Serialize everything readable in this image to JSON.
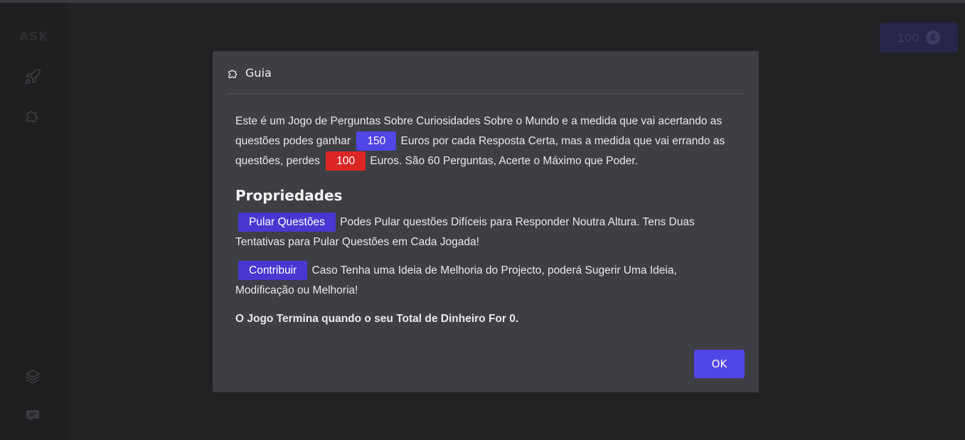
{
  "sidebar": {
    "logo": "ASK",
    "icons": [
      "rocket-icon",
      "puzzle-icon",
      "layers-icon",
      "chat-icon"
    ]
  },
  "header": {
    "money": "100",
    "currency_icon": "euro-icon",
    "currency_symbol": "€"
  },
  "modal": {
    "icon": "puzzle-icon",
    "title": "Guia",
    "intro_part1": "Este é um Jogo de Perguntas Sobre Curiosidades Sobre o Mundo e a medida que vai acertando as questões podes ganhar",
    "gain_value": "150",
    "intro_part2": "Euros por cada Resposta Certa, mas a medida que vai errando as questões, perdes",
    "loss_value": "100",
    "intro_part3": "Euros. São 60 Perguntas, Acerte o Máximo que Poder.",
    "properties_title": "Propriedades",
    "skip_label": "Pular Questões",
    "skip_text": "Podes Pular questões Difíceis para Responder Noutra Altura. Tens Duas Tentativas para Pular Questões em Cada Jogada!",
    "contribute_label": "Contribuir",
    "contribute_text": "Caso Tenha uma Ideia de Melhoria do Projecto, poderá Sugerir Uma Ideia, Modificação ou Melhoria!",
    "ending_text": "O Jogo Termina quando o seu Total de Dinheiro For 0.",
    "ok_label": "OK"
  },
  "colors": {
    "accent": "#4f46e5",
    "danger": "#dc2626",
    "modal_bg": "#3e3f44",
    "page_bg": "#222225"
  }
}
